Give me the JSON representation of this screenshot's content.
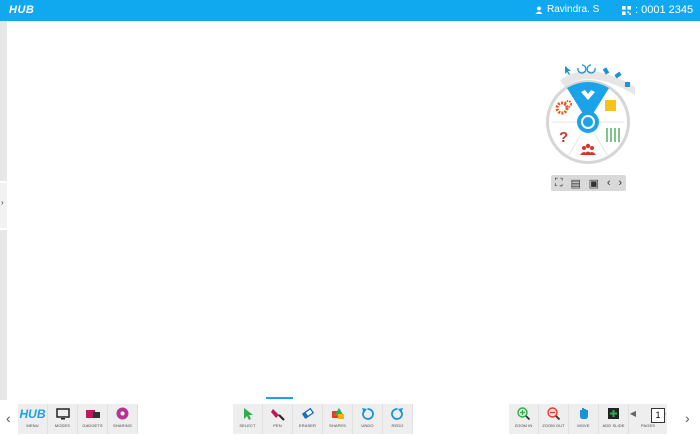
{
  "header": {
    "logo": "HUB",
    "user_name": "Ravindra. S",
    "session_code": ": 0001 2345"
  },
  "wheel": {
    "top_icons": [
      "select-cursor-icon",
      "undo-icon",
      "redo-icon",
      "pen-icon",
      "eraser-icon",
      "shapes-icon"
    ],
    "segments": [
      "pen-segment",
      "notes-segment",
      "widgets-segment",
      "participants-segment",
      "help-segment",
      "settings-segment"
    ],
    "sub_icons": [
      "screenshot-icon",
      "open-icon",
      "save-icon",
      "prev-icon",
      "next-icon"
    ]
  },
  "toolbar_left": [
    {
      "label": "MENU",
      "icon": "hub-logo-icon"
    },
    {
      "label": "MODES",
      "icon": "monitor-icon"
    },
    {
      "label": "GADGETS",
      "icon": "gadgets-icon"
    },
    {
      "label": "SHARING",
      "icon": "sharing-icon"
    }
  ],
  "toolbar_center": [
    {
      "label": "SELECT",
      "icon": "select-icon"
    },
    {
      "label": "PEN",
      "icon": "pen-icon"
    },
    {
      "label": "ERASER",
      "icon": "eraser-icon"
    },
    {
      "label": "SHAPES",
      "icon": "shapes-icon"
    },
    {
      "label": "UNDO",
      "icon": "undo-icon"
    },
    {
      "label": "REDO",
      "icon": "redo-icon"
    }
  ],
  "toolbar_right": [
    {
      "label": "ZOOM IN",
      "icon": "zoom-in-icon"
    },
    {
      "label": "ZOOM OUT",
      "icon": "zoom-out-icon"
    },
    {
      "label": "MOVE",
      "icon": "move-hand-icon"
    },
    {
      "label": "ADD SLIDE",
      "icon": "add-slide-icon"
    },
    {
      "label": "PAGES",
      "icon": "pages-icon"
    }
  ],
  "pages": {
    "current": "1"
  },
  "colors": {
    "accent": "#10a8ef",
    "pen": "#c0185f",
    "toolbar_bg": "#eeeeee"
  }
}
